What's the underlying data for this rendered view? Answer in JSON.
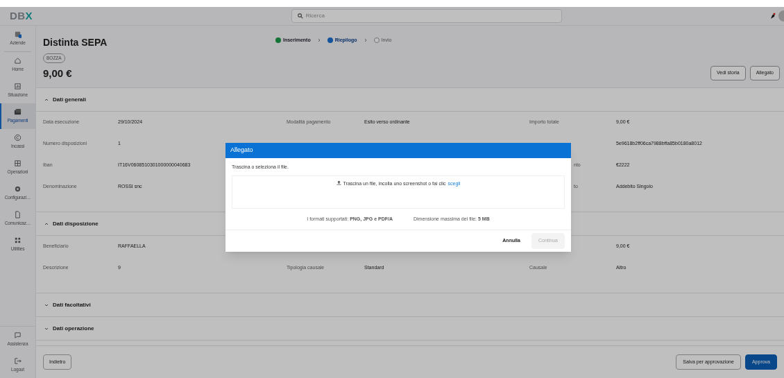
{
  "top_bar": {
    "logo": [
      "DB",
      "X"
    ],
    "search": {
      "placeholder": "Ricerca"
    }
  },
  "sidebar": {
    "items": [
      {
        "label": "Aziende",
        "selected": false
      },
      {
        "label": "Home",
        "selected": false
      },
      {
        "label": "Situazione",
        "selected": false
      },
      {
        "label": "Pagamenti",
        "selected": true
      },
      {
        "label": "Incassi",
        "selected": false
      },
      {
        "label": "Operazioni",
        "selected": false
      },
      {
        "label": "Configurazi…",
        "selected": false
      },
      {
        "label": "Comunicaz…",
        "selected": false
      },
      {
        "label": "Utilities",
        "selected": false
      }
    ],
    "bottom_items": [
      {
        "label": "Assistenza"
      },
      {
        "label": "Logout"
      }
    ]
  },
  "header": {
    "title": "Distinta SEPA",
    "badge": "BOZZA",
    "amount": "9,00 €",
    "steps": [
      {
        "label": "Inserimento",
        "completed": true,
        "selected": false
      },
      {
        "label": "Riepilogo",
        "completed": false,
        "selected": true
      },
      {
        "label": "Invio",
        "completed": false,
        "selected": false
      }
    ],
    "buttons": [
      "Vedi storia",
      "Allegato"
    ]
  },
  "sections": [
    {
      "title": "Dati generali",
      "expanded": true,
      "rows": [
        {
          "column_1": {
            "label": "Data esecuzione",
            "value": "29/10/2024"
          },
          "column_2": {
            "label": "Modalità pagamento",
            "value": "Esito verso ordinante"
          },
          "column_3": {
            "label": "Importo totale",
            "value": "9,00 €"
          }
        },
        {
          "column_1": {
            "label": "Numero disposizioni",
            "value": "1"
          },
          "column_3": {
            "value": "5e9618b2ff06ca7988bffa85b0180a8012"
          }
        },
        {
          "column_1": {
            "label": "Iban",
            "value": "IT16V0608510301000000040683"
          },
          "column_3": {
            "label": "nto",
            "kind": "partial",
            "value": "€2222"
          }
        },
        {
          "column_1": {
            "label": "Denominazione",
            "value": "ROSSI snc"
          },
          "column_3": {
            "label": "to",
            "kind": "partial",
            "value": "Addebito Singolo"
          }
        }
      ]
    },
    {
      "title": "Dati disposizione",
      "expanded": true,
      "rows": [
        {
          "column_1": {
            "label": "Beneficiario",
            "value": "RAFFAELLA"
          },
          "column_3": {
            "value": "9,00 €"
          }
        },
        {
          "column_1": {
            "label": "Descrizione",
            "value": "9"
          },
          "column_2": {
            "label": "Tipologia causale",
            "value": "Standard"
          },
          "column_3": {
            "label": "Causale",
            "value": "Altro"
          }
        }
      ]
    },
    {
      "title": "Dati facoltativi",
      "expanded": false
    },
    {
      "title": "Dati operazione",
      "expanded": false
    }
  ],
  "footer": {
    "back": "Indietro",
    "buttons": [
      {
        "label": "Salva per approvazione",
        "kind": "secondary"
      },
      {
        "label": "Approva",
        "kind": "primary"
      }
    ]
  },
  "dialog": {
    "title": "Allegato",
    "hint": "Trascina o seleziona il file.",
    "drop_text": "Trascina un file, incolla uno screenshot o fai clic",
    "drop_link": "scegli",
    "formats": "I formati supportati: **PNG, JPG e PDF/A**",
    "max_size": "Dimensione massima del file: **5 MB**",
    "buttons": [
      {
        "label": "Annulla",
        "disabled": false
      },
      {
        "label": "Continua",
        "disabled": true
      }
    ]
  }
}
